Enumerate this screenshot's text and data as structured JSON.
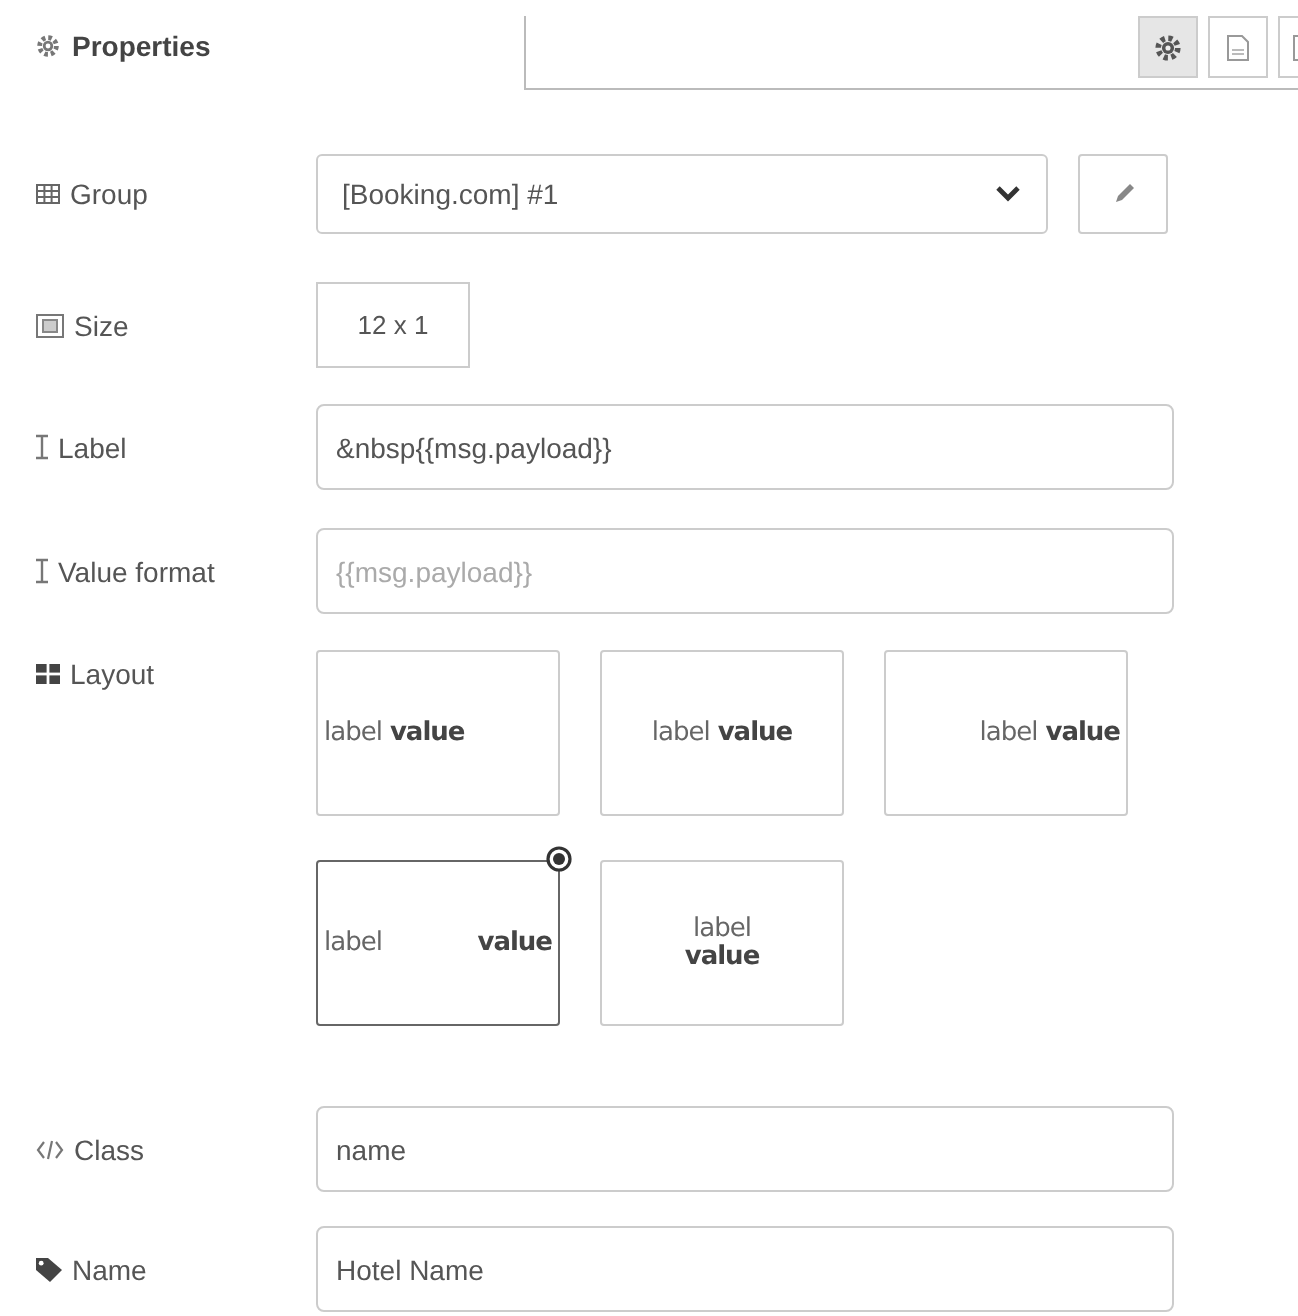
{
  "header": {
    "title": "Properties"
  },
  "tab_buttons": [
    {
      "kind": "gear",
      "selected": true
    },
    {
      "kind": "document",
      "selected": false
    },
    {
      "kind": "frame",
      "selected": false
    }
  ],
  "group": {
    "label": "Group",
    "value": "[Booking.com] #1"
  },
  "size": {
    "label": "Size",
    "value": "12 x 1"
  },
  "label_field": {
    "label": "Label",
    "value": "&nbsp{{msg.payload}}"
  },
  "value_format": {
    "label": "Value format",
    "placeholder": "{{msg.payload}}"
  },
  "layout": {
    "label": "Layout",
    "options": [
      {
        "kind": "left",
        "label": "label",
        "value": "value",
        "selected": false
      },
      {
        "kind": "center",
        "label": "label",
        "value": "value",
        "selected": false
      },
      {
        "kind": "right",
        "label": "label",
        "value": "value",
        "selected": false
      },
      {
        "kind": "spread",
        "label": "label",
        "value": "value",
        "selected": true
      },
      {
        "kind": "stacked",
        "label": "label",
        "value": "value",
        "selected": false
      }
    ]
  },
  "class_field": {
    "label": "Class",
    "value": "name"
  },
  "name_field": {
    "label": "Name",
    "value": "Hotel Name"
  }
}
